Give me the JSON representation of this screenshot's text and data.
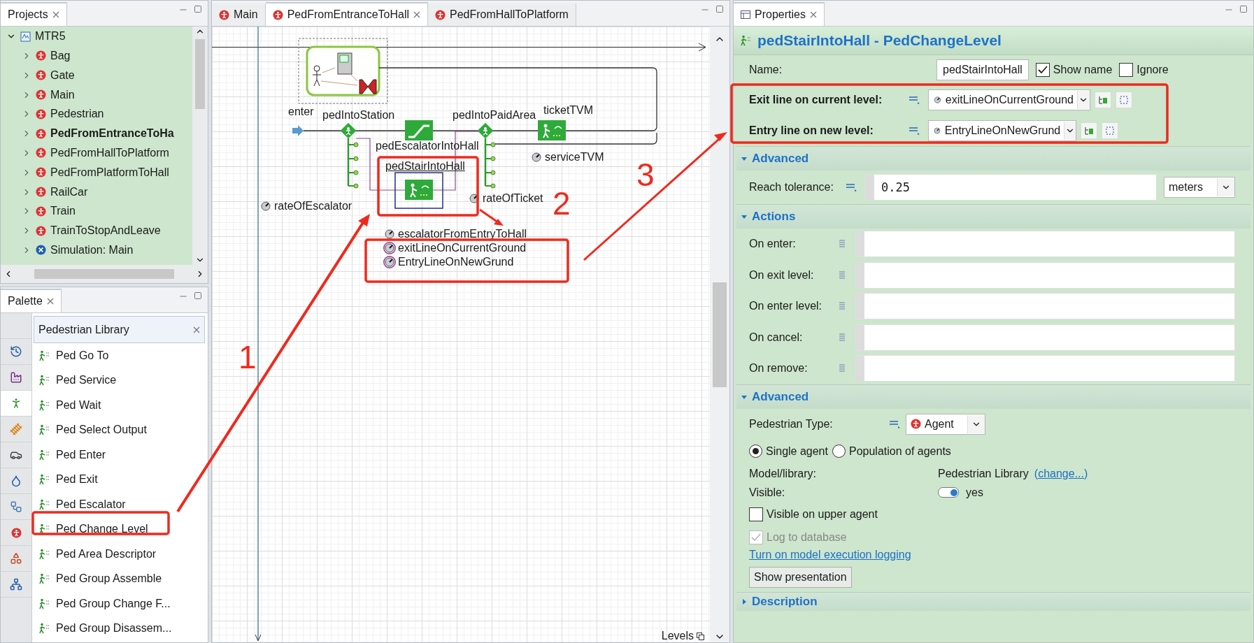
{
  "projects_panel": {
    "title": "Projects",
    "root": {
      "label": "MTR5",
      "expanded": true,
      "children": [
        {
          "label": "Bag",
          "kind": "agent",
          "active": false
        },
        {
          "label": "Gate",
          "kind": "agent",
          "active": false
        },
        {
          "label": "Main",
          "kind": "agent",
          "active": false
        },
        {
          "label": "Pedestrian",
          "kind": "agent",
          "active": false
        },
        {
          "label": "PedFromEntranceToHa",
          "kind": "agent",
          "active": true
        },
        {
          "label": "PedFromHallToPlatform",
          "kind": "agent",
          "active": false
        },
        {
          "label": "PedFromPlatformToHall",
          "kind": "agent",
          "active": false
        },
        {
          "label": "RailCar",
          "kind": "agent",
          "active": false
        },
        {
          "label": "Train",
          "kind": "agent",
          "active": false
        },
        {
          "label": "TrainToStopAndLeave",
          "kind": "agent",
          "active": false
        },
        {
          "label": "Simulation: Main",
          "kind": "simulation",
          "active": false
        }
      ]
    }
  },
  "palette": {
    "title": "Palette",
    "library": "Pedestrian Library",
    "categories": [
      {
        "kind": "history",
        "selected": false
      },
      {
        "kind": "factory",
        "selected": false
      },
      {
        "kind": "pedestrian",
        "selected": true
      },
      {
        "kind": "rail",
        "selected": false
      },
      {
        "kind": "car",
        "selected": false
      },
      {
        "kind": "fluid",
        "selected": false
      },
      {
        "kind": "blocks",
        "selected": false
      },
      {
        "kind": "agent",
        "selected": false
      },
      {
        "kind": "shapes",
        "selected": false
      },
      {
        "kind": "network",
        "selected": false
      }
    ],
    "items": [
      "Ped Go To",
      "Ped Service",
      "Ped Wait",
      "Ped Select Output",
      "Ped Enter",
      "Ped Exit",
      "Ped Escalator",
      "Ped Change Level",
      "Ped Area Descriptor",
      "Ped Group Assemble",
      "Ped Group Change F...",
      "Ped Group Disassem..."
    ]
  },
  "editor": {
    "tabs": [
      {
        "label": "Main",
        "selected": false
      },
      {
        "label": "PedFromEntranceToHall",
        "selected": true
      },
      {
        "label": "PedFromHallToPlatform",
        "selected": false
      }
    ],
    "blocks": [
      {
        "name": "enter",
        "kind": "source",
        "selected": false
      },
      {
        "name": "pedIntoStation",
        "kind": "select",
        "selected": false
      },
      {
        "name": "pedEscalatorIntoHall",
        "kind": "escalator",
        "selected": false
      },
      {
        "name": "pedIntoPaidArea",
        "kind": "select",
        "selected": false
      },
      {
        "name": "ticketTVM",
        "kind": "service",
        "selected": false
      },
      {
        "name": "pedStairIntoHall",
        "kind": "change_level",
        "selected": true
      }
    ],
    "parameters": [
      {
        "name": "serviceTVM",
        "highlighted": false
      },
      {
        "name": "rateOfEscalator",
        "highlighted": false
      },
      {
        "name": "rateOfTicket",
        "highlighted": false
      },
      {
        "name": "escalatorFromEntryToHall",
        "highlighted": false
      },
      {
        "name": "exitLineOnCurrentGround",
        "highlighted": true
      },
      {
        "name": "EntryLineOnNewGrund",
        "highlighted": true
      }
    ],
    "levels_label": "Levels"
  },
  "properties": {
    "title": "Properties",
    "header": "pedStairIntoHall - PedChangeLevel",
    "name_field": {
      "label": "Name:",
      "value": "pedStairIntoHall"
    },
    "show_name": {
      "label": "Show name",
      "checked": true
    },
    "ignore": {
      "label": "Ignore",
      "checked": false
    },
    "level_lines": [
      {
        "label": "Exit line on current level:",
        "value": "exitLineOnCurrentGround"
      },
      {
        "label": "Entry line on new level:",
        "value": "EntryLineOnNewGrund"
      }
    ],
    "advanced_1": {
      "title": "Advanced",
      "expanded": true,
      "reach_tolerance": {
        "label": "Reach tolerance:",
        "value": "0.25",
        "unit": "meters"
      }
    },
    "actions": {
      "title": "Actions",
      "expanded": true,
      "fields": [
        "On enter:",
        "On exit level:",
        "On enter level:",
        "On cancel:",
        "On remove:"
      ]
    },
    "advanced_2": {
      "title": "Advanced",
      "expanded": true,
      "pedestrian_type": {
        "label": "Pedestrian Type:",
        "value": "Agent"
      },
      "agent_mode": [
        {
          "label": "Single agent",
          "selected": true
        },
        {
          "label": "Population of agents",
          "selected": false
        }
      ],
      "model_library": {
        "label": "Model/library:",
        "value": "Pedestrian Library",
        "link": "(change...)"
      },
      "visible": {
        "label": "Visible:",
        "value": "yes",
        "on": true
      },
      "visible_on_upper": {
        "label": "Visible on upper agent",
        "checked": false
      },
      "log_to_database": {
        "label": "Log to database",
        "checked": true,
        "disabled": true
      },
      "logging_link": "Turn on model execution logging",
      "button": "Show presentation"
    },
    "description": {
      "title": "Description",
      "expanded": false
    }
  },
  "annotations": [
    "1",
    "2",
    "3"
  ]
}
